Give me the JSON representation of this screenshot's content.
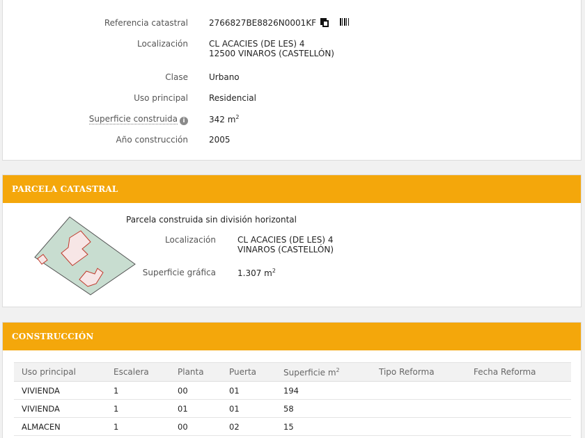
{
  "inmueble": {
    "rows": [
      {
        "label": "Referencia catastral",
        "value": "2766827BE8826N0001KF",
        "icons": [
          "copy-icon",
          "barcode-icon"
        ]
      },
      {
        "label": "Localización",
        "value_line1": "CL ACACIES (DE LES) 4",
        "value_line2": "12500 VINAROS (CASTELLÓN)"
      },
      {
        "label": "Clase",
        "value": "Urbano"
      },
      {
        "label": "Uso principal",
        "value": "Residencial"
      },
      {
        "label": "Superficie construida",
        "value": "342 m",
        "unit_sup": "2",
        "info_icon": "i"
      },
      {
        "label": "Año construcción",
        "value": "2005"
      }
    ]
  },
  "parcela": {
    "title": "PARCELA CATASTRAL",
    "intro": "Parcela construida sin división horizontal",
    "localizacion_label": "Localización",
    "localizacion_line1": "CL ACACIES (DE LES) 4",
    "localizacion_line2": "VINAROS (CASTELLÓN)",
    "superficie_label": "Superficie gráfica",
    "superficie_value": "1.307 m",
    "superficie_sup": "2"
  },
  "construccion": {
    "title": "CONSTRUCCIÓN",
    "headers": [
      "Uso principal",
      "Escalera",
      "Planta",
      "Puerta",
      "Superficie m",
      "Tipo Reforma",
      "Fecha Reforma"
    ],
    "header_sup": "2",
    "rows": [
      [
        "VIVIENDA",
        "1",
        "00",
        "01",
        "194",
        "",
        ""
      ],
      [
        "VIVIENDA",
        "1",
        "01",
        "01",
        "58",
        "",
        ""
      ],
      [
        "ALMACEN",
        "1",
        "00",
        "02",
        "15",
        "",
        ""
      ]
    ]
  },
  "colors": {
    "accent": "#f4a70b",
    "parcel_fill": "#c8ddd0",
    "building_stroke": "#c0392b"
  }
}
